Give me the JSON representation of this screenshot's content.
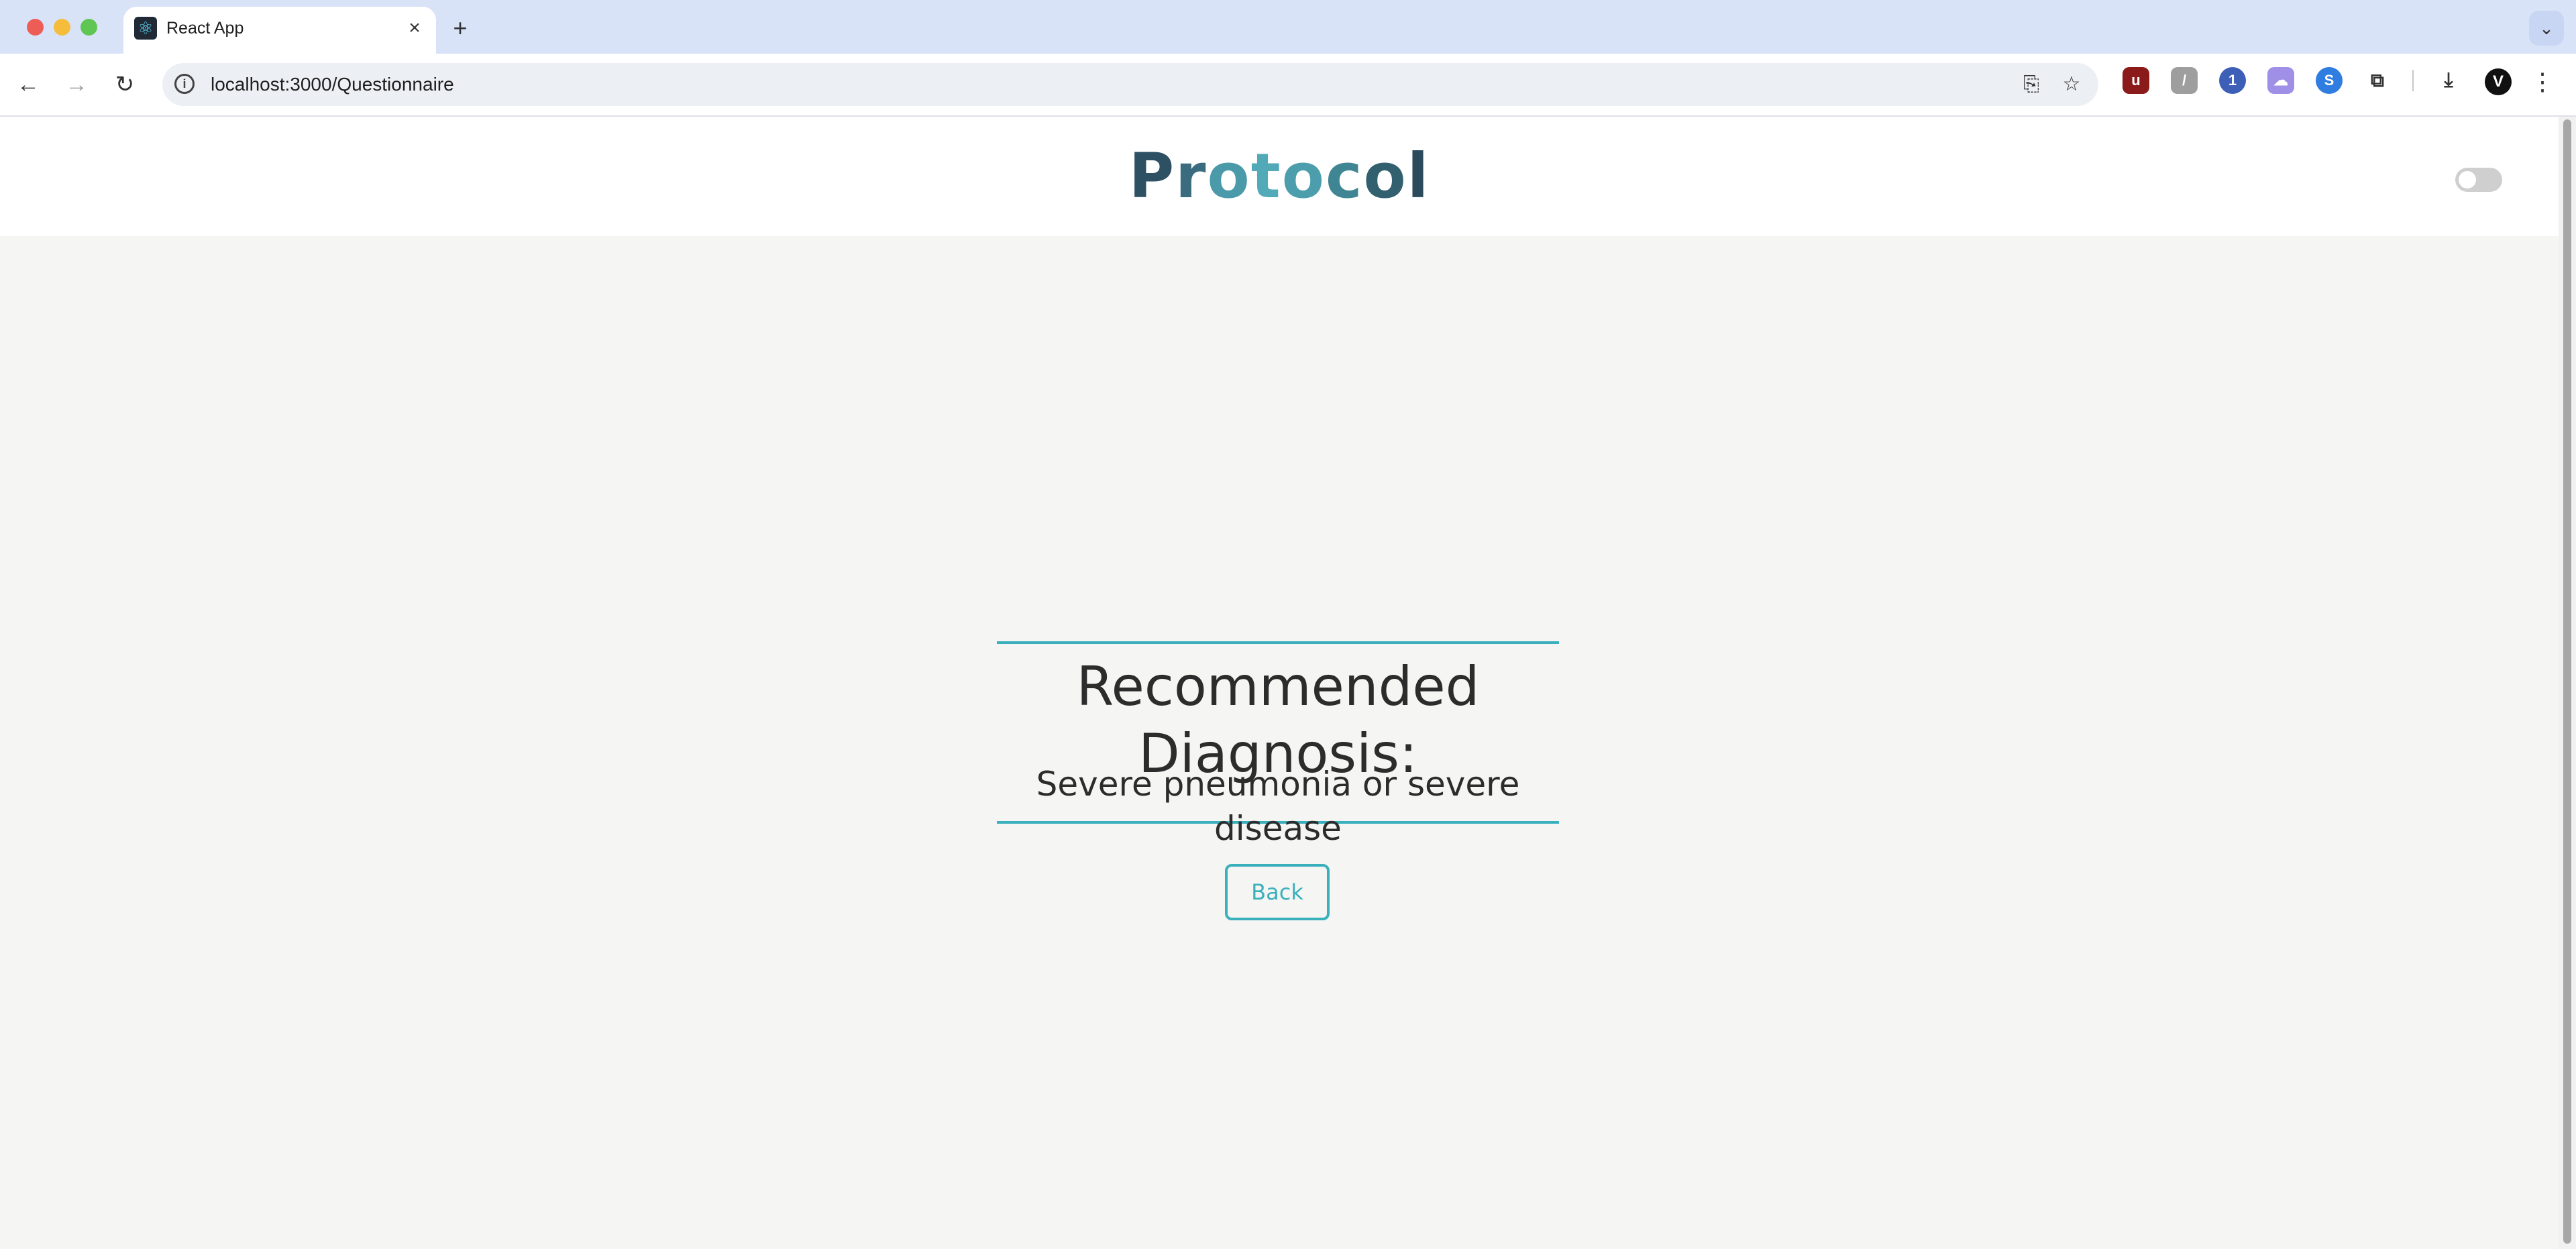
{
  "browser": {
    "tab_title": "React App",
    "tab_favicon": "react-icon",
    "url": "localhost:3000/Questionnaire",
    "avatar_letter": "V"
  },
  "header": {
    "logo_letters": [
      "P",
      "r",
      "o",
      "t",
      "o",
      "c",
      "o",
      "l"
    ],
    "logo_colors": [
      "#2d5063",
      "#3a6b7e",
      "#4a9aaa",
      "#52a9b7",
      "#4d9eac",
      "#3f8593",
      "#33606f",
      "#2b4a5b"
    ],
    "theme_toggle_on": false
  },
  "result": {
    "heading": "Recommended Diagnosis:",
    "value": "Severe pneumonia or severe disease"
  },
  "actions": {
    "back_label": "Back"
  },
  "colors": {
    "accent": "#3bb0bd",
    "page_bg": "#f5f5f3",
    "text": "#2c2c2c"
  }
}
